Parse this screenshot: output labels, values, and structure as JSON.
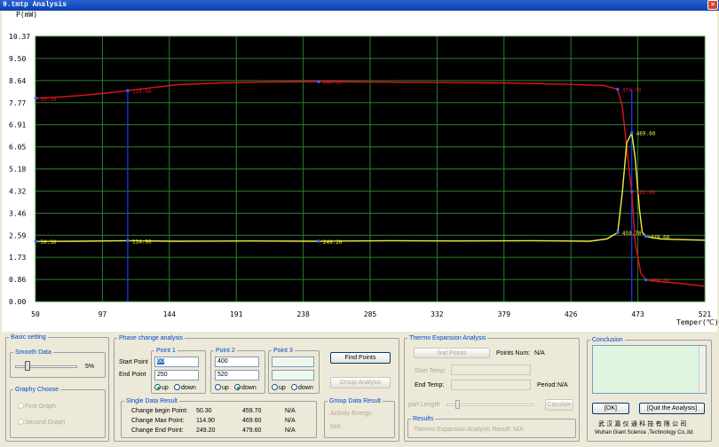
{
  "window": {
    "title": "9.tmtp  Analysis",
    "close_label": "✕"
  },
  "chart_data": {
    "type": "line",
    "ylabel": "P(mW)",
    "xlabel": "Temper(℃)",
    "x_ticks": [
      "50",
      "97",
      "144",
      "191",
      "238",
      "285",
      "332",
      "379",
      "426",
      "473",
      "521"
    ],
    "y_ticks": [
      "10.37",
      "9.50",
      "8.64",
      "7.77",
      "6.91",
      "6.05",
      "5.18",
      "4.32",
      "3.46",
      "2.59",
      "1.73",
      "0.86",
      "0.00"
    ],
    "xlim": [
      50,
      521
    ],
    "ylim": [
      0,
      10.37
    ],
    "series": [
      {
        "color": "#e0141e",
        "x": [
          50,
          60,
          80,
          100,
          115,
          130,
          150,
          180,
          210,
          249,
          290,
          330,
          380,
          420,
          450,
          459.7,
          463,
          466,
          469.6,
          472,
          476,
          479.6,
          490,
          505,
          521
        ],
        "values": [
          7.95,
          7.98,
          8.05,
          8.15,
          8.25,
          8.35,
          8.48,
          8.55,
          8.58,
          8.6,
          8.58,
          8.57,
          8.55,
          8.5,
          8.45,
          8.3,
          7.6,
          6.0,
          4.3,
          2.3,
          1.1,
          0.85,
          0.78,
          0.7,
          0.6
        ]
      },
      {
        "color": "#f0f040",
        "x": [
          50,
          80,
          114.9,
          150,
          200,
          249.2,
          300,
          350,
          400,
          440,
          452,
          459.7,
          463,
          466,
          469.6,
          472,
          475,
          477,
          479.6,
          490,
          505,
          521
        ],
        "values": [
          2.35,
          2.36,
          2.38,
          2.36,
          2.37,
          2.36,
          2.38,
          2.37,
          2.38,
          2.36,
          2.45,
          2.7,
          4.3,
          6.2,
          6.6,
          5.6,
          3.6,
          2.7,
          2.55,
          2.45,
          2.42,
          2.4
        ]
      }
    ],
    "vlines": [
      114.9,
      469.6
    ],
    "markers": [
      {
        "x": 50.3,
        "y": 7.95,
        "label": "50.30",
        "color": "#e0141e"
      },
      {
        "x": 114.9,
        "y": 8.25,
        "label": "114.90",
        "color": "#e0141e"
      },
      {
        "x": 249.2,
        "y": 8.6,
        "label": "249.20",
        "color": "#e0141e"
      },
      {
        "x": 459.7,
        "y": 8.3,
        "label": "459.70",
        "color": "#e0141e"
      },
      {
        "x": 469.6,
        "y": 4.3,
        "label": "469.60",
        "color": "#e0141e"
      },
      {
        "x": 479.6,
        "y": 0.85,
        "label": "479.60",
        "color": "#e0141e"
      },
      {
        "x": 50.3,
        "y": 2.35,
        "label": "50.30",
        "color": "#f0f040"
      },
      {
        "x": 114.9,
        "y": 2.38,
        "label": "114.90",
        "color": "#f0f040"
      },
      {
        "x": 249.2,
        "y": 2.36,
        "label": "249.20",
        "color": "#f0f040"
      },
      {
        "x": 459.7,
        "y": 2.7,
        "label": "459.70",
        "color": "#f0f040"
      },
      {
        "x": 469.6,
        "y": 6.6,
        "label": "469.60",
        "color": "#f0f040"
      },
      {
        "x": 479.6,
        "y": 2.55,
        "label": "479.60",
        "color": "#f0f040"
      }
    ]
  },
  "basic": {
    "legend": "Basic setting",
    "smooth_legend": "Smooth Data",
    "smooth_value": "5%",
    "graph_legend": "Graphy Choose",
    "first_graph": "First Graph",
    "second_graph": "Second Graph"
  },
  "phase": {
    "legend": "Phase change analysis",
    "start_label": "Start Point",
    "end_label": "End Point",
    "p1_legend": "Point 1",
    "p1_start": "60",
    "p1_end": "250",
    "p2_legend": "Point 2",
    "p2_start": "400",
    "p2_end": "520",
    "p3_legend": "Point 3",
    "p3_start": "",
    "p3_end": "",
    "up": "up",
    "down": "down",
    "find_points": "Find Points",
    "group_analysis": "Group Analysis",
    "single_legend": "Single Data Result",
    "rows": [
      {
        "label": "Change begin Point:",
        "v1": "50.30",
        "v2": "459.70",
        "v3": "N/A"
      },
      {
        "label": "Change Max Point:",
        "v1": "114.90",
        "v2": "469.60",
        "v3": "N/A"
      },
      {
        "label": "Change End Point:",
        "v1": "249.20",
        "v2": "479.60",
        "v3": "N/A"
      }
    ],
    "group_legend": "Group Data Result",
    "activity_label": "Activity Energy:",
    "activity_value": "N/A"
  },
  "thermo": {
    "legend": "Thermo Expansion Analysis",
    "find_points": "find Points",
    "points_num_label": "Points Num:",
    "points_num_value": "N/A",
    "start_temp": "Start Temp:",
    "end_temp": "End Temp:",
    "period_label": "Period:",
    "period_value": "N/A",
    "part_length": "part Length",
    "calculate": "Caculate",
    "results_legend": "Results",
    "result_label": "Thermo Expansion Analysis Result:",
    "result_value": "N/A"
  },
  "conclusion": {
    "legend": "Conclusion",
    "ok": "[OK]",
    "quit": "[Quit the Analysis]",
    "company_cn": "武 汉 嘉 仪 通 科 技 有 限 公 司",
    "company_en": "Wuhan Giant Science ,Technology Co.,ltd"
  }
}
